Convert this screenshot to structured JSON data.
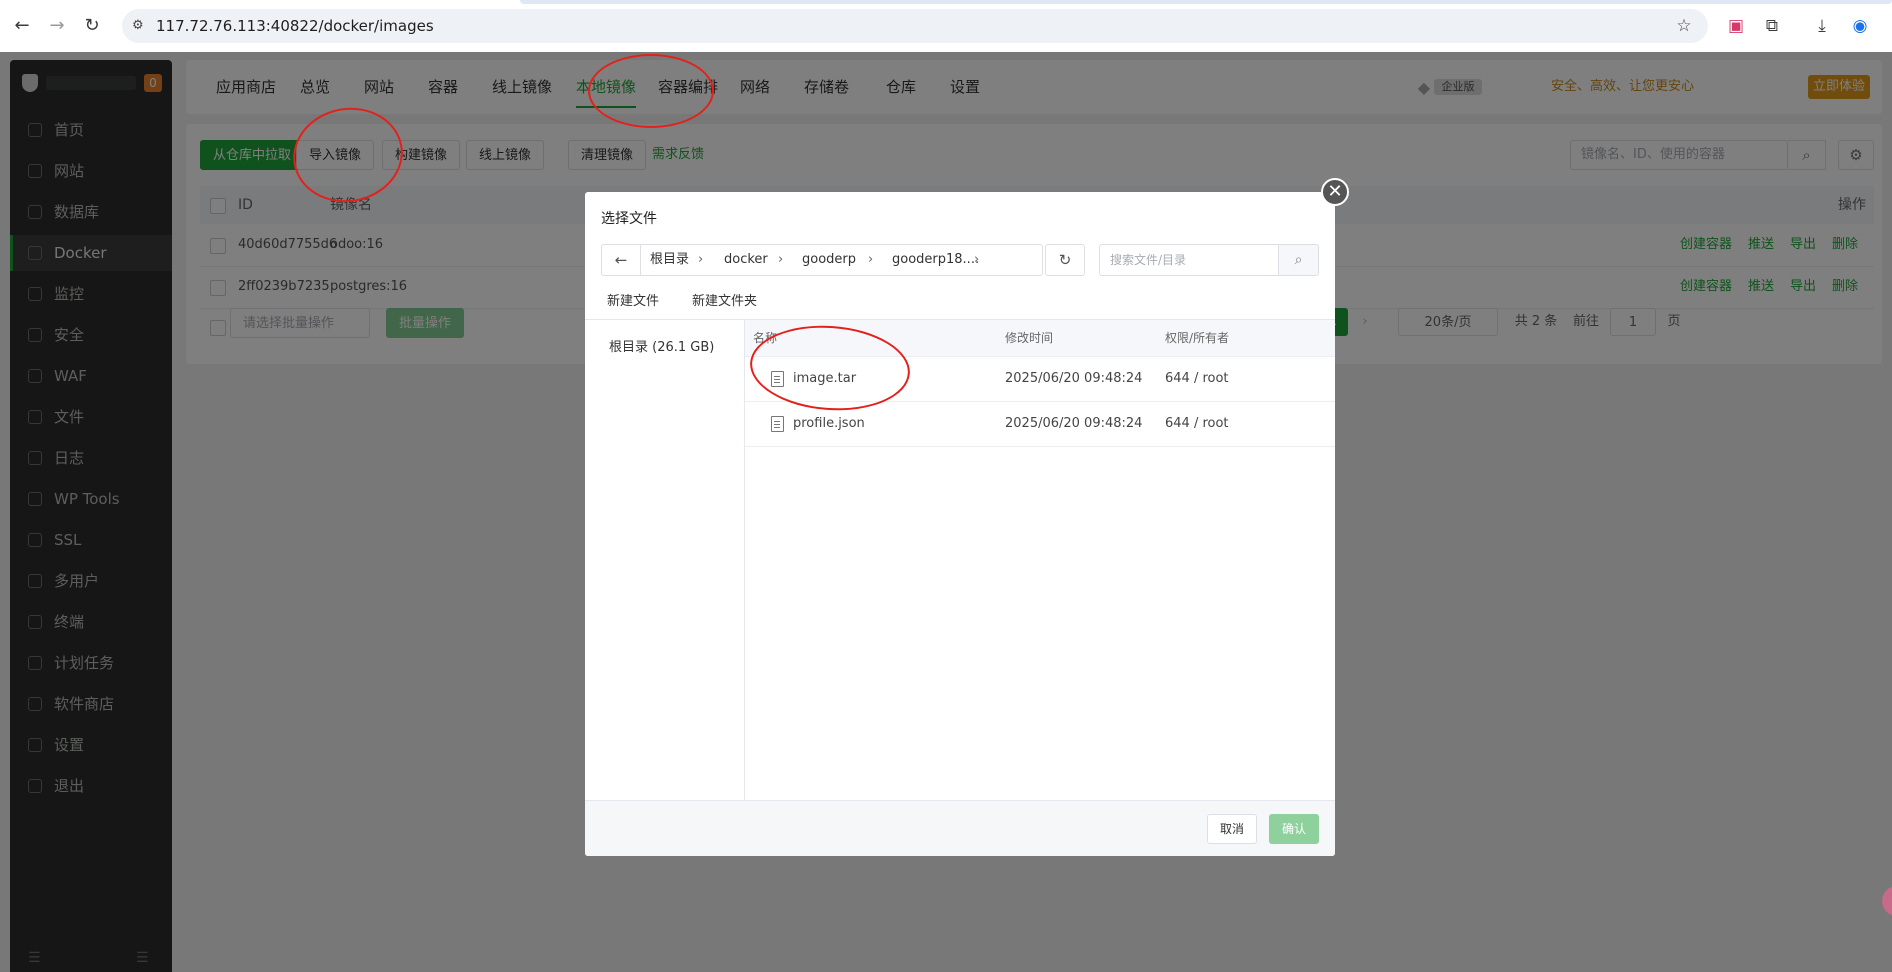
{
  "browser": {
    "url": "117.72.76.113:40822/docker/images",
    "back_icon": "arrow-left",
    "forward_icon": "arrow-right",
    "reload_icon": "reload"
  },
  "sidebar": {
    "badge": "0",
    "items": [
      {
        "label": "首页"
      },
      {
        "label": "网站"
      },
      {
        "label": "数据库"
      },
      {
        "label": "Docker"
      },
      {
        "label": "监控"
      },
      {
        "label": "安全"
      },
      {
        "label": "WAF"
      },
      {
        "label": "文件"
      },
      {
        "label": "日志"
      },
      {
        "label": "WP Tools"
      },
      {
        "label": "SSL"
      },
      {
        "label": "多用户"
      },
      {
        "label": "终端"
      },
      {
        "label": "计划任务"
      },
      {
        "label": "软件商店"
      },
      {
        "label": "设置"
      },
      {
        "label": "退出"
      }
    ]
  },
  "topnav": {
    "tabs": [
      {
        "label": "应用商店"
      },
      {
        "label": "总览"
      },
      {
        "label": "网站"
      },
      {
        "label": "容器"
      },
      {
        "label": "线上镜像"
      },
      {
        "label": "本地镜像"
      },
      {
        "label": "容器编排"
      },
      {
        "label": "网络"
      },
      {
        "label": "存储卷"
      },
      {
        "label": "仓库"
      },
      {
        "label": "设置"
      }
    ],
    "promo_badge": "企业版",
    "promo_text": "安全、高效、让您更安心",
    "promo_button": "立即体验"
  },
  "toolbar": {
    "pull": "从仓库中拉取",
    "import": "导入镜像",
    "build": "构建镜像",
    "online": "线上镜像",
    "clean": "清理镜像",
    "feedback": "需求反馈",
    "search_placeholder": "镜像名、ID、使用的容器"
  },
  "table": {
    "headers": {
      "id": "ID",
      "name": "镜像名",
      "ops": "操作"
    },
    "rows": [
      {
        "id": "40d60d7755d6",
        "name": "odoo:16"
      },
      {
        "id": "2ff0239b7235",
        "name": "postgres:16"
      }
    ],
    "ops": {
      "create": "创建容器",
      "push": "推送",
      "export": "导出",
      "delete": "删除"
    },
    "batch_placeholder": "请选择批量操作",
    "batch_button": "批量操作"
  },
  "pager": {
    "current": "1",
    "page_size": "20条/页",
    "total": "共 2 条",
    "goto": "前往",
    "goto_value": "1",
    "page_suffix": "页"
  },
  "dialog": {
    "title": "选择文件",
    "breadcrumb": [
      "根目录",
      "docker",
      "gooderp",
      "gooderp18...."
    ],
    "search_placeholder": "搜索文件/目录",
    "new_file": "新建文件",
    "new_folder": "新建文件夹",
    "tree_root": "根目录 (26.1 GB)",
    "columns": {
      "name": "名称",
      "mtime": "修改时间",
      "perm": "权限/所有者"
    },
    "files": [
      {
        "name": "image.tar",
        "mtime": "2025/06/20 09:48:24",
        "perm": "644 / root"
      },
      {
        "name": "profile.json",
        "mtime": "2025/06/20 09:48:24",
        "perm": "644 / root"
      }
    ],
    "cancel": "取消",
    "confirm": "确认"
  },
  "accent": "#20a53a",
  "annotation_color": "#e3211b"
}
